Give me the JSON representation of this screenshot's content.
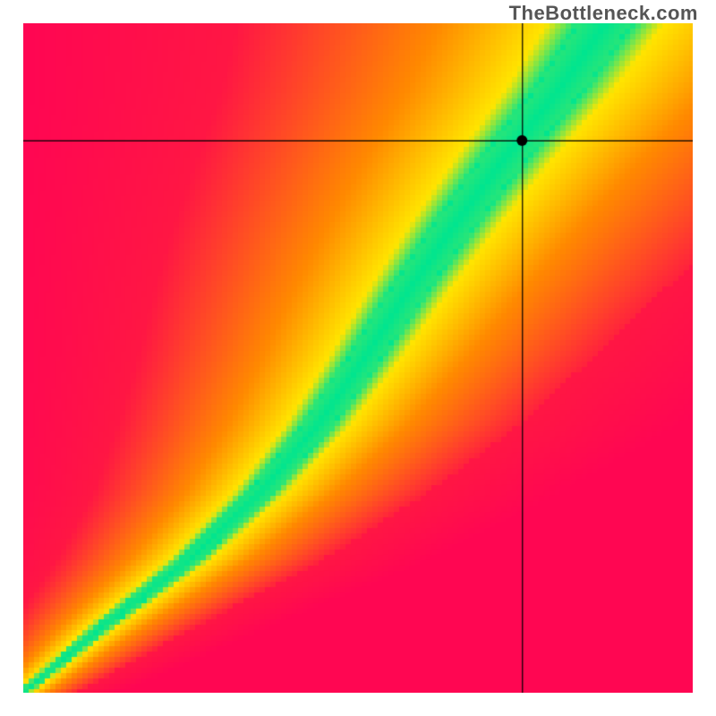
{
  "watermark": "TheBottleneck.com",
  "chart_data": {
    "type": "heatmap",
    "title": "",
    "xlabel": "",
    "ylabel": "",
    "xlim": [
      0,
      1
    ],
    "ylim": [
      0,
      1
    ],
    "crosshair": {
      "x": 0.745,
      "y": 0.825
    },
    "marker": {
      "x": 0.745,
      "y": 0.825,
      "radius": 6
    },
    "optimal_curve": {
      "description": "green ridge of optimal pairing; x=f(y)",
      "samples": [
        {
          "y": 0.0,
          "x": 0.0
        },
        {
          "y": 0.1,
          "x": 0.12
        },
        {
          "y": 0.2,
          "x": 0.25
        },
        {
          "y": 0.3,
          "x": 0.355
        },
        {
          "y": 0.4,
          "x": 0.44
        },
        {
          "y": 0.5,
          "x": 0.51
        },
        {
          "y": 0.6,
          "x": 0.575
        },
        {
          "y": 0.7,
          "x": 0.645
        },
        {
          "y": 0.8,
          "x": 0.72
        },
        {
          "y": 0.9,
          "x": 0.8
        },
        {
          "y": 1.0,
          "x": 0.87
        }
      ]
    },
    "ridge_halfwidth": {
      "description": "approximate half-width of green band in x units as function of y",
      "samples": [
        {
          "y": 0.0,
          "width": 0.008
        },
        {
          "y": 0.2,
          "width": 0.02
        },
        {
          "y": 0.4,
          "width": 0.03
        },
        {
          "y": 0.6,
          "width": 0.038
        },
        {
          "y": 0.8,
          "width": 0.046
        },
        {
          "y": 1.0,
          "width": 0.055
        }
      ]
    },
    "color_stops": {
      "green": "#00e690",
      "yellow": "#ffe500",
      "orange": "#ff8a00",
      "red": "#ff1744",
      "magenta": "#ff0059"
    }
  }
}
